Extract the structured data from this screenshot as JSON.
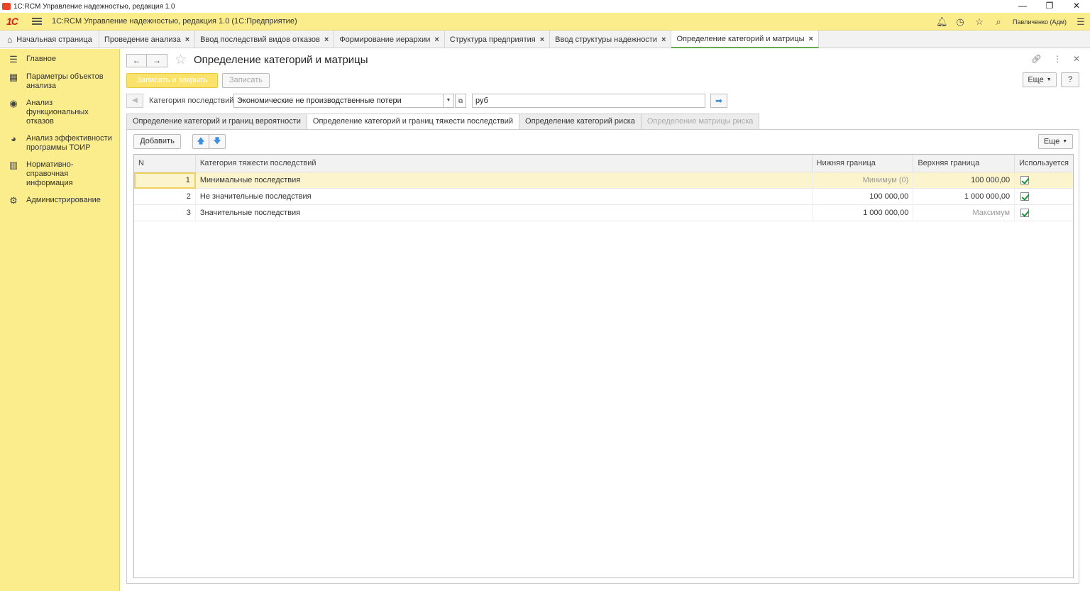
{
  "window": {
    "title": "1С:RCM Управление надежностью, редакция 1.0",
    "controls": [
      "—",
      "❐",
      "✕"
    ]
  },
  "app_header": {
    "logo": "1С",
    "title": "1С:RCM Управление надежностью, редакция 1.0  (1С:Предприятие)",
    "user": "Павличенко (Адм)"
  },
  "open_tabs": [
    {
      "label": "Начальная страница"
    },
    {
      "label": "Проведение анализа"
    },
    {
      "label": "Ввод последствий видов отказов"
    },
    {
      "label": "Формирование иерархии"
    },
    {
      "label": "Структура предприятия"
    },
    {
      "label": "Ввод структуры надежности"
    },
    {
      "label": "Определение категорий и матрицы"
    }
  ],
  "sidebar": {
    "items": [
      {
        "label": "Главное"
      },
      {
        "label": "Параметры объектов анализа"
      },
      {
        "label": "Анализ функциональных отказов"
      },
      {
        "label": "Анализ эффективности программы ТОИР"
      },
      {
        "label": "Нормативно-справочная информация"
      },
      {
        "label": "Администрирование"
      }
    ]
  },
  "form": {
    "title": "Определение категорий и матрицы",
    "save_close_label": "Записать и закрыть",
    "save_label": "Записать",
    "more_label": "Еще",
    "help_label": "?",
    "category_label": "Категория последствий:",
    "category_value": "Экономические не производственные потери",
    "unit_value": "руб",
    "tabs": [
      {
        "label": "Определение категорий и границ вероятности"
      },
      {
        "label": "Определение категорий и границ тяжести последствий"
      },
      {
        "label": "Определение категорий риска"
      },
      {
        "label": "Определение матрицы риска"
      }
    ],
    "add_label": "Добавить",
    "table_more_label": "Еще",
    "columns": {
      "n": "N",
      "category": "Категория тяжести последствий",
      "lower": "Нижняя граница",
      "upper": "Верхняя граница",
      "used": "Используется"
    },
    "rows": [
      {
        "n": "1",
        "category": "Минимальные последствия",
        "lower": "Минимум (0)",
        "upper": "100 000,00",
        "used": true
      },
      {
        "n": "2",
        "category": "Не значительные последствия",
        "lower": "100 000,00",
        "upper": "1 000 000,00",
        "used": true
      },
      {
        "n": "3",
        "category": "Значительные последствия",
        "lower": "1 000 000,00",
        "upper": "Максимум",
        "used": true
      }
    ]
  }
}
